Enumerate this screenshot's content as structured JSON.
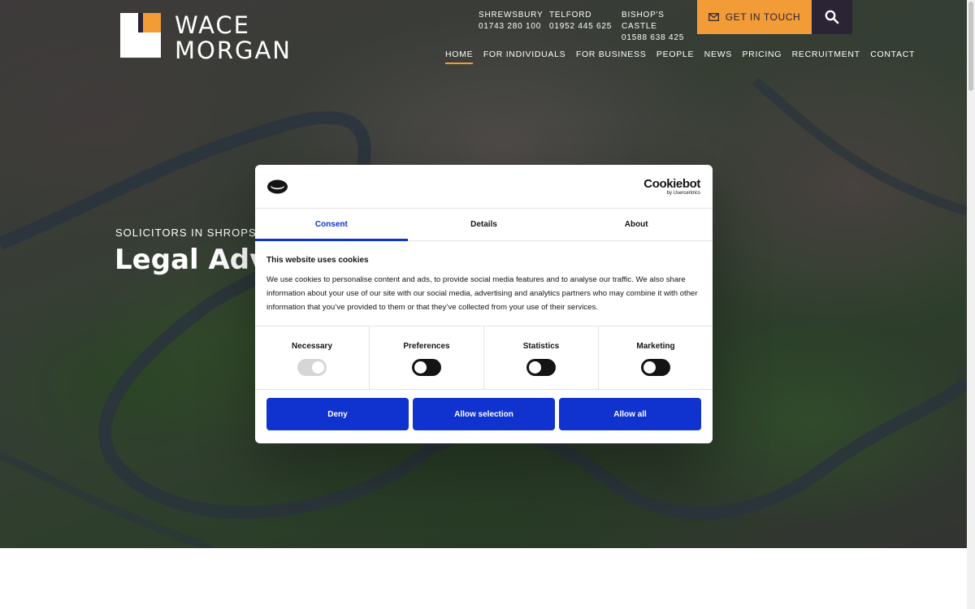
{
  "brand": {
    "line1": "WACE",
    "line2": "MORGAN"
  },
  "offices": [
    {
      "name": "SHREWSBURY",
      "phone": "01743 280 100"
    },
    {
      "name": "TELFORD",
      "phone": "01952 445 625"
    },
    {
      "name": "BISHOP'S CASTLE",
      "phone": "01588 638 425"
    }
  ],
  "cta": {
    "label": "GET IN TOUCH",
    "icon": "mail-icon"
  },
  "search": {
    "icon": "search-icon"
  },
  "nav": [
    "HOME",
    "FOR INDIVIDUALS",
    "FOR BUSINESS",
    "PEOPLE",
    "NEWS",
    "PRICING",
    "RECRUITMENT",
    "CONTACT"
  ],
  "nav_active": "HOME",
  "hero": {
    "kicker": "SOLICITORS IN SHROPSHIRE",
    "title": "Legal Advice"
  },
  "cookie_dialog": {
    "logo_icon": "cookie-icon",
    "provider": "Cookiebot",
    "provider_sub": "by Usercentrics",
    "tabs": [
      "Consent",
      "Details",
      "About"
    ],
    "active_tab": "Consent",
    "heading": "This website uses cookies",
    "body": "We use cookies to personalise content and ads, to provide social media features and to analyse our traffic. We also share information about your use of our site with our social media, advertising and analytics partners who may combine it with other information that you’ve provided to them or that they’ve collected from your use of their services.",
    "toggles": [
      {
        "label": "Necessary",
        "state": "on-locked"
      },
      {
        "label": "Preferences",
        "state": "off"
      },
      {
        "label": "Statistics",
        "state": "off"
      },
      {
        "label": "Marketing",
        "state": "off"
      }
    ],
    "buttons": {
      "deny": "Deny",
      "allow_selection": "Allow selection",
      "allow_all": "Allow all"
    }
  },
  "colors": {
    "accent": "#f29c38",
    "dark": "#2a2434",
    "cookie_blue": "#1032cf"
  }
}
